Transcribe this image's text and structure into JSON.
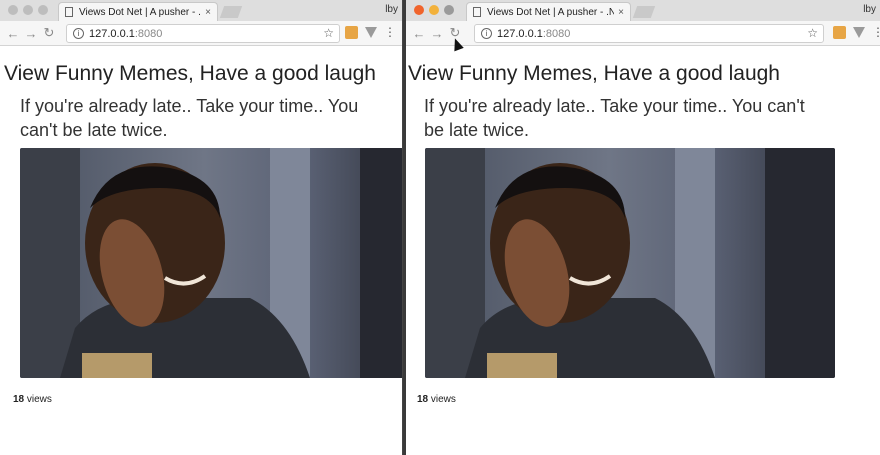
{
  "browser": {
    "tab_title": "Views Dot Net | A pusher - .Net",
    "tab_close": "×",
    "user_label": "lby",
    "url_host": "127.0.0.1",
    "url_port": ":8080",
    "info_glyph": "i",
    "bookmark_glyph": "☆",
    "back_glyph": "←",
    "forward_glyph": "→",
    "reload_glyph": "↻",
    "menu_glyph": "⋮"
  },
  "page": {
    "heading": "View Funny Memes, Have a good laugh",
    "caption": "If you're already late.. Take your time.. You can't be late twice.",
    "views_count": "18",
    "views_label": " views"
  },
  "colors": {
    "close_button": "#f0642c",
    "minimize_button": "#f2b13b",
    "extension_accent": "#e7a545"
  }
}
